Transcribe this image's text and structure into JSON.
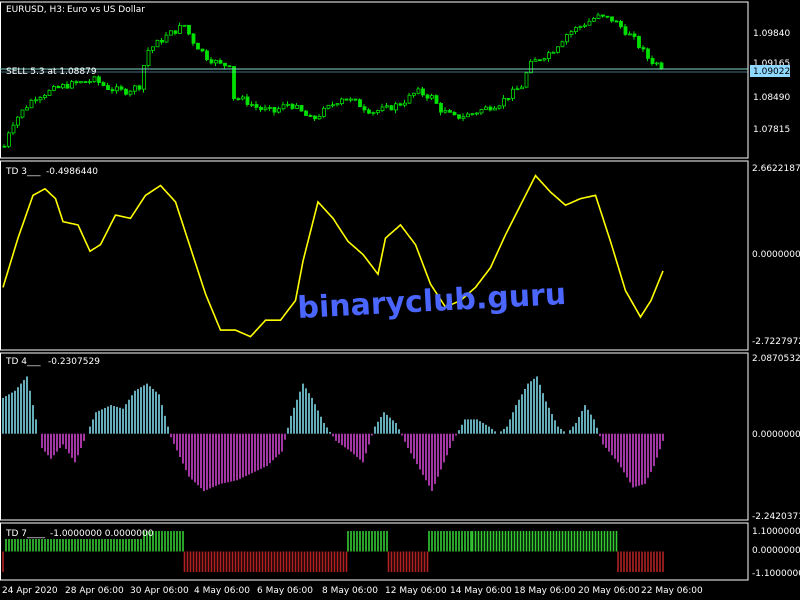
{
  "colors": {
    "background": "#000000",
    "grid": "#ffffff",
    "candle": "#00e000",
    "line": "#ffff00",
    "hist_pos": "#7fd7e8",
    "hist_neg": "#cc44cc",
    "bar_up": "#33cc33",
    "bar_down": "#b22222",
    "sell_line": "#7fd7c9",
    "price_tag": "#8fd8ff"
  },
  "watermark": "binaryclub.guru",
  "panes": [
    {
      "id": "price",
      "label_parts": [
        "EURUSD, H3:",
        "Euro vs US Dollar"
      ],
      "sell_label": "SELL 5.3 at 1.08879",
      "price_tag": "1.09022",
      "ticks": [
        "1.09840",
        "1.09165",
        "1.08490",
        "1.07815"
      ]
    },
    {
      "id": "td3",
      "label_parts": [
        "TD 3___",
        "-0.4986440"
      ],
      "ticks": [
        "2.6622187",
        "0.0000000",
        "-2.7227972"
      ]
    },
    {
      "id": "td4",
      "label_parts": [
        "TD 4___",
        "-0.2307529"
      ],
      "ticks": [
        "2.0870532",
        "0.0000000",
        "-2.2420371"
      ]
    },
    {
      "id": "td7",
      "label_parts": [
        "TD 7____",
        "-1.0000000 0.0000000"
      ],
      "ticks": [
        "1.1000000",
        "0.0000000",
        "-1.1000000"
      ]
    }
  ],
  "x_axis": {
    "labels": [
      "24 Apr 2020",
      "28 Apr 06:00",
      "30 Apr 06:00",
      "4 May 06:00",
      "6 May 06:00",
      "8 May 06:00",
      "12 May 06:00",
      "14 May 06:00",
      "18 May 06:00",
      "20 May 06:00",
      "22 May 06:00"
    ]
  },
  "chart_data": [
    {
      "type": "candlestick",
      "name": "EURUSD, H3",
      "ylim": [
        1.0755,
        1.1005
      ],
      "anchors": [
        [
          0,
          1.0765
        ],
        [
          4,
          1.08
        ],
        [
          10,
          1.082
        ],
        [
          20,
          1.085
        ],
        [
          30,
          1.086
        ],
        [
          40,
          1.087
        ],
        [
          60,
          1.088
        ],
        [
          70,
          1.0865
        ],
        [
          80,
          1.086
        ],
        [
          90,
          1.087
        ],
        [
          95,
          1.093
        ],
        [
          100,
          1.094
        ],
        [
          110,
          1.096
        ],
        [
          120,
          1.0975
        ],
        [
          125,
          1.095
        ],
        [
          135,
          1.092
        ],
        [
          145,
          1.0905
        ],
        [
          152,
          1.091
        ],
        [
          153,
          1.085
        ],
        [
          160,
          1.0845
        ],
        [
          170,
          1.083
        ],
        [
          180,
          1.0825
        ],
        [
          190,
          1.084
        ],
        [
          195,
          1.083
        ],
        [
          205,
          1.081
        ],
        [
          215,
          1.083
        ],
        [
          225,
          1.085
        ],
        [
          235,
          1.084
        ],
        [
          245,
          1.0825
        ],
        [
          255,
          1.083
        ],
        [
          265,
          1.084
        ],
        [
          275,
          1.086
        ],
        [
          285,
          1.085
        ],
        [
          290,
          1.083
        ],
        [
          300,
          1.0815
        ],
        [
          310,
          1.082
        ],
        [
          320,
          1.083
        ],
        [
          330,
          1.084
        ],
        [
          345,
          1.087
        ],
        [
          350,
          1.0905
        ],
        [
          355,
          1.0915
        ],
        [
          365,
          1.093
        ],
        [
          375,
          1.096
        ],
        [
          385,
          1.0975
        ],
        [
          395,
          1.099
        ],
        [
          405,
          1.0985
        ],
        [
          410,
          1.0975
        ],
        [
          420,
          1.095
        ],
        [
          430,
          1.0915
        ],
        [
          440,
          1.0902
        ]
      ]
    },
    {
      "type": "line",
      "name": "TD 3",
      "ylim": [
        -2.7227972,
        2.6622187
      ],
      "anchors": [
        [
          0,
          -1.0
        ],
        [
          10,
          0.5
        ],
        [
          20,
          1.8
        ],
        [
          28,
          2.0
        ],
        [
          35,
          1.7
        ],
        [
          40,
          1.0
        ],
        [
          50,
          0.9
        ],
        [
          58,
          0.1
        ],
        [
          65,
          0.3
        ],
        [
          75,
          1.2
        ],
        [
          85,
          1.1
        ],
        [
          95,
          1.8
        ],
        [
          105,
          2.1
        ],
        [
          115,
          1.6
        ],
        [
          125,
          0.2
        ],
        [
          135,
          -1.2
        ],
        [
          145,
          -2.3
        ],
        [
          155,
          -2.3
        ],
        [
          165,
          -2.5
        ],
        [
          175,
          -2.0
        ],
        [
          185,
          -2.0
        ],
        [
          195,
          -1.4
        ],
        [
          200,
          -0.2
        ],
        [
          210,
          1.6
        ],
        [
          220,
          1.1
        ],
        [
          230,
          0.4
        ],
        [
          240,
          0.0
        ],
        [
          250,
          -0.6
        ],
        [
          255,
          0.5
        ],
        [
          265,
          0.9
        ],
        [
          275,
          0.3
        ],
        [
          285,
          -0.9
        ],
        [
          295,
          -1.6
        ],
        [
          305,
          -1.4
        ],
        [
          315,
          -1.0
        ],
        [
          325,
          -0.4
        ],
        [
          335,
          0.6
        ],
        [
          345,
          1.5
        ],
        [
          355,
          2.4
        ],
        [
          365,
          1.9
        ],
        [
          375,
          1.5
        ],
        [
          385,
          1.7
        ],
        [
          395,
          1.8
        ],
        [
          405,
          0.4
        ],
        [
          415,
          -1.1
        ],
        [
          425,
          -1.9
        ],
        [
          432,
          -1.4
        ],
        [
          440,
          -0.5
        ]
      ]
    },
    {
      "type": "histogram",
      "name": "TD 4",
      "ylim": [
        -2.2420371,
        2.0870532
      ],
      "anchors": [
        [
          0,
          1.0
        ],
        [
          8,
          1.2
        ],
        [
          16,
          1.6
        ],
        [
          22,
          0.4
        ],
        [
          26,
          -0.4
        ],
        [
          32,
          -0.7
        ],
        [
          40,
          -0.3
        ],
        [
          48,
          -0.8
        ],
        [
          55,
          -0.1
        ],
        [
          62,
          0.6
        ],
        [
          72,
          0.8
        ],
        [
          80,
          0.7
        ],
        [
          88,
          1.2
        ],
        [
          96,
          1.4
        ],
        [
          104,
          1.1
        ],
        [
          112,
          -0.1
        ],
        [
          124,
          -1.2
        ],
        [
          134,
          -1.6
        ],
        [
          145,
          -1.4
        ],
        [
          156,
          -1.3
        ],
        [
          166,
          -1.1
        ],
        [
          176,
          -0.9
        ],
        [
          186,
          -0.5
        ],
        [
          192,
          0.5
        ],
        [
          200,
          1.4
        ],
        [
          206,
          1.0
        ],
        [
          214,
          0.3
        ],
        [
          222,
          -0.2
        ],
        [
          232,
          -0.5
        ],
        [
          240,
          -0.8
        ],
        [
          248,
          0.2
        ],
        [
          254,
          0.6
        ],
        [
          262,
          0.3
        ],
        [
          270,
          -0.4
        ],
        [
          278,
          -1.0
        ],
        [
          286,
          -1.6
        ],
        [
          292,
          -1.0
        ],
        [
          300,
          -0.2
        ],
        [
          308,
          0.4
        ],
        [
          316,
          0.4
        ],
        [
          324,
          0.2
        ],
        [
          330,
          0.0
        ],
        [
          336,
          0.2
        ],
        [
          342,
          0.8
        ],
        [
          350,
          1.4
        ],
        [
          356,
          1.6
        ],
        [
          362,
          0.9
        ],
        [
          370,
          0.2
        ],
        [
          376,
          0.0
        ],
        [
          382,
          0.3
        ],
        [
          388,
          0.8
        ],
        [
          394,
          0.4
        ],
        [
          400,
          -0.3
        ],
        [
          410,
          -0.8
        ],
        [
          420,
          -1.5
        ],
        [
          428,
          -1.4
        ],
        [
          434,
          -0.9
        ],
        [
          440,
          -0.2
        ]
      ]
    },
    {
      "type": "bar",
      "name": "TD 7",
      "ylim": [
        -1.1,
        1.1
      ],
      "segments": [
        [
          0,
          1,
          -1
        ],
        [
          2,
          120,
          1
        ],
        [
          121,
          229,
          -1
        ],
        [
          230,
          256,
          1
        ],
        [
          257,
          283,
          -1
        ],
        [
          284,
          312,
          1
        ],
        [
          313,
          409,
          1
        ],
        [
          410,
          440,
          -1
        ]
      ]
    }
  ]
}
